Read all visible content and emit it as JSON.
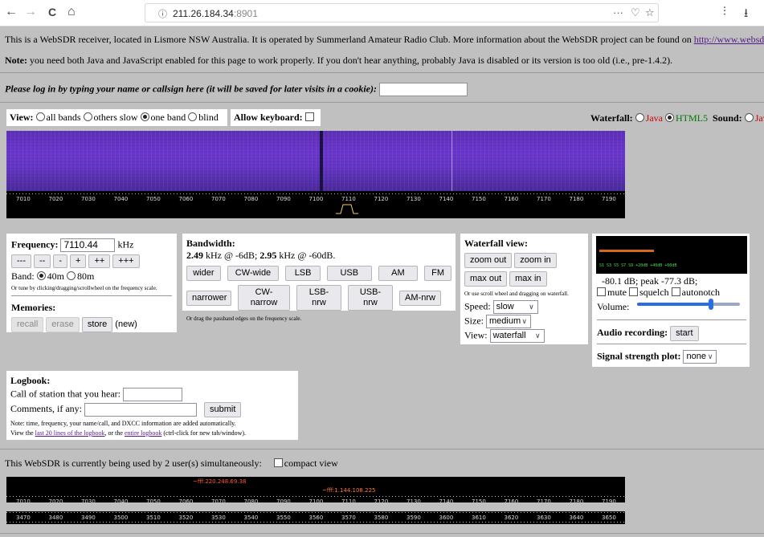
{
  "browser": {
    "back_glyph": "←",
    "forward_glyph": "→",
    "reload_glyph": "C",
    "home_glyph": "⌂",
    "info_glyph": "ⓘ",
    "address_host": "211.26.184.34",
    "address_port": ":8901",
    "more_glyph": "···",
    "pocket_glyph": "♡",
    "star_glyph": "☆",
    "library_glyph": "⫶",
    "download_glyph": "⭳"
  },
  "intro": {
    "line1_pre": "This is a WebSDR receiver, located in Lismore NSW Australia. It is operated by Summerland Amateur Radio Club. More information about the WebSDR project can be found on ",
    "line1_link": "http://www.websdr.org",
    "note_label": "Note:",
    "note_text": " you need both Java and JavaScript enabled for this page to work properly. If you don't hear anything, probably Java is disabled or its version is too old (i.e., pre-1.4.2)."
  },
  "login": {
    "prompt": "Please log in by typing your name or callsign here (it will be saved for later visits in a cookie):",
    "value": ""
  },
  "view_bar": {
    "view_label": "View:",
    "view_options": [
      "all bands",
      "others slow",
      "one band",
      "blind"
    ],
    "view_selected": "one band",
    "keyboard_label": "Allow keyboard:",
    "waterfall_label": "Waterfall:",
    "waterfall_java": "Java",
    "waterfall_html5": "HTML5",
    "sound_label": "Sound:",
    "sound_java": "Java"
  },
  "frequency_scale": [
    "7010",
    "7020",
    "7030",
    "7040",
    "7050",
    "7060",
    "7070",
    "7080",
    "7090",
    "7100",
    "7110",
    "7120",
    "7130",
    "7140",
    "7150",
    "7160",
    "7170",
    "7180",
    "7190"
  ],
  "frequency_panel": {
    "label": "Frequency:",
    "value": "7110.44",
    "unit": "kHz",
    "step_buttons": [
      "---",
      "--",
      "-",
      "+",
      "++",
      "+++"
    ],
    "band_label": "Band:",
    "bands": [
      "40m",
      "80m"
    ],
    "band_selected": "40m",
    "tune_hint": "Or tune by clicking/dragging/scrollwheel on the frequency scale.",
    "memories_label": "Memories:",
    "memory_buttons": [
      "recall",
      "erase",
      "store"
    ],
    "memory_status": "(new)"
  },
  "bandwidth_panel": {
    "label": "Bandwidth:",
    "bw1_value": "2.49",
    "bw1_text": " kHz @ -6dB; ",
    "bw2_value": "2.95",
    "bw2_text": " kHz @ -60dB.",
    "row1": [
      "wider",
      "CW-wide",
      "LSB",
      "USB",
      "AM",
      "FM"
    ],
    "row2": [
      "narrower",
      "CW-narrow",
      "LSB-nrw",
      "USB-nrw",
      "AM-nrw"
    ],
    "hint": "Or drag the passband edges on the frequency scale."
  },
  "waterfall_panel": {
    "label": "Waterfall view:",
    "row1": [
      "zoom out",
      "zoom in"
    ],
    "row2": [
      "max out",
      "max in"
    ],
    "hint": "Or use scroll wheel and dragging on waterfall.",
    "speed_label": "Speed:",
    "speed_value": "slow",
    "size_label": "Size:",
    "size_value": "medium",
    "view_label": "View:",
    "view_value": "waterfall"
  },
  "audio_panel": {
    "meter_scale": "S1   S3   S5   S7   S9    +20dB  +40dB  +60dB",
    "meter_level": 0.38,
    "dB_text": "-80.1 dB; peak  -77.3 dB;",
    "checks": [
      "mute",
      "squelch",
      "autonotch"
    ],
    "volume_label": "Volume:",
    "volume_level": 0.72,
    "recording_label": "Audio recording:",
    "recording_button": "start",
    "plot_label": "Signal strength plot:",
    "plot_value": "none"
  },
  "logbook": {
    "title": "Logbook:",
    "call_label": "Call of station that you hear:",
    "comments_label": "Comments, if any:",
    "submit": "submit",
    "note": "Note: time, frequency, your name/call, and DXCC information are added automatically.",
    "view_pre": "View the ",
    "link1": "last 20 lines of the logbook",
    "view_mid": ", or the ",
    "link2": "entire logbook",
    "view_post": " (ctrl-click for new tab/window)."
  },
  "users_line": {
    "text": "This WebSDR is currently being used by 2 user(s) simultaneously:",
    "compact_label": "compact view",
    "user1": "~fff:220.248.69.38",
    "user2": "~fff:1.144.108.225"
  },
  "band80_scale": [
    "3470",
    "3480",
    "3490",
    "3500",
    "3510",
    "3520",
    "3530",
    "3540",
    "3550",
    "3560",
    "3570",
    "3580",
    "3590",
    "3600",
    "3610",
    "3620",
    "3630",
    "3640",
    "3650"
  ]
}
